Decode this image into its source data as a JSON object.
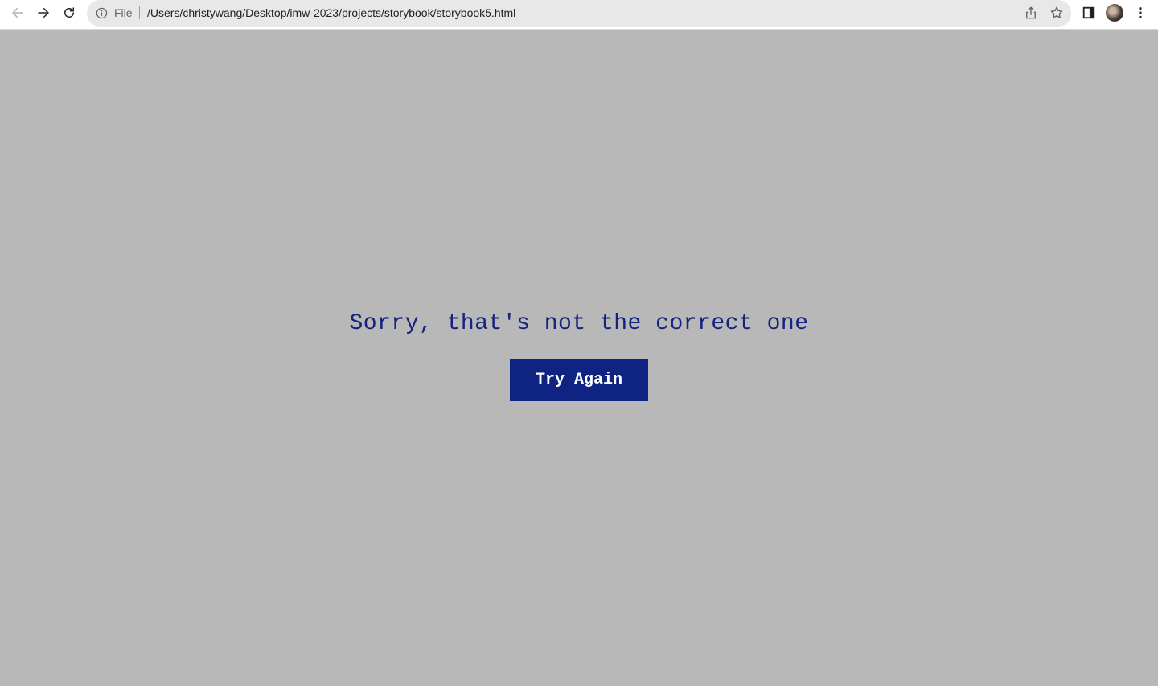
{
  "browser": {
    "scheme_label": "File",
    "url": "/Users/christywang/Desktop/imw-2023/projects/storybook/storybook5.html",
    "icons": {
      "back": "arrow-left-icon",
      "forward": "arrow-right-icon",
      "reload": "reload-icon",
      "site_info": "info-icon",
      "share": "share-icon",
      "bookmark": "star-icon",
      "side_panel": "side-panel-icon",
      "profile": "avatar",
      "menu": "more-vertical-icon"
    }
  },
  "page": {
    "message": "Sorry, that's not the correct one",
    "button_label": "Try Again",
    "colors": {
      "background": "#b8b8b8",
      "text": "#14237f",
      "button_bg": "#0f2382",
      "button_text": "#ffffff"
    }
  }
}
